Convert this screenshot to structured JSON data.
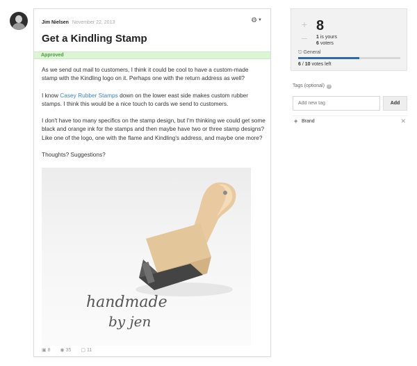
{
  "post": {
    "author": "Jim Nielsen",
    "date": "November 22, 2013",
    "title": "Get a Kindling Stamp",
    "status": "Approved",
    "paragraphs": {
      "p1": "As we send out mail to customers, I think it could be cool to have a custom-made stamp with the Kindling logo on it. Perhaps one with the return address as well?",
      "p2_before": "I know ",
      "p2_link": "Casey Rubber Stamps",
      "p2_after": " down on the lower east side makes custom rubber stamps. I think this would be a nice touch to cards we send to customers.",
      "p3": "I don't have too many specifics on the stamp design, but I'm thinking we could get some black and orange ink for the stamps and then maybe have two or three stamp designs? Like one of the logo, one with the flame and Kindling's address, and maybe one more?",
      "p4": "Thoughts? Suggestions?"
    },
    "image_text": "handmade by jen",
    "stats": {
      "votes": "8",
      "views": "35",
      "comments": "11"
    }
  },
  "vote": {
    "count": "8",
    "yours_num": "1",
    "yours_text": "is yours",
    "voters_num": "6",
    "voters_text": "voters",
    "category": "General",
    "used": "6",
    "total": "10",
    "left_text": "votes left",
    "progress": 0.6
  },
  "tags": {
    "label": "Tags (optional)",
    "placeholder": "Add new tag",
    "add_label": "Add",
    "items": [
      {
        "name": "Brand"
      }
    ]
  },
  "colors": {
    "link": "#3b7ec4",
    "approved_bg": "#ddf5d6",
    "approved_text": "#4a9a3a",
    "progress": "#2f6aa8"
  },
  "icons": {
    "settings": "gear-icon",
    "vote_up": "plus-icon",
    "vote_down": "minus-icon",
    "category": "org-chart-icon",
    "help": "question-icon",
    "tag": "tag-icon",
    "remove": "close-icon",
    "votes_stat": "vote-box-icon",
    "views_stat": "eye-icon",
    "comments_stat": "comment-icon"
  }
}
